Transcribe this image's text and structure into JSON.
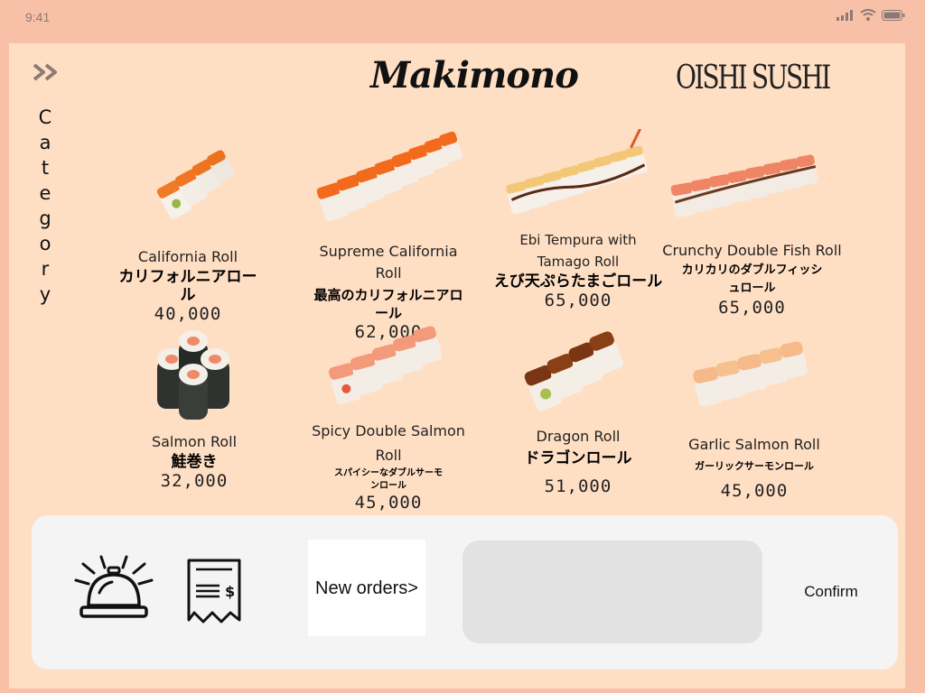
{
  "status_bar": {
    "time": "9:41"
  },
  "header": {
    "title": "Makimono",
    "brand": "OISHI SUSHI",
    "category_label": [
      "C",
      "a",
      "t",
      "e",
      "g",
      "o",
      "r",
      "y"
    ]
  },
  "menu": {
    "items": [
      {
        "name": "California Roll",
        "name_jp": "カリフォルニアロール",
        "price": "40,000"
      },
      {
        "name": "Supreme California Roll",
        "name_jp": "最高のカリフォルニアロール",
        "price": "62,000"
      },
      {
        "name": "Ebi Tempura with Tamago Roll",
        "name_jp": "えび天ぷらたまごロール",
        "price": "65,000"
      },
      {
        "name": "Crunchy Double Fish Roll",
        "name_jp": "カリカリのダブルフィッシュロール",
        "price": "65,000"
      },
      {
        "name": "Salmon Roll",
        "name_jp": "鮭巻き",
        "price": "32,000"
      },
      {
        "name": "Spicy Double Salmon Roll",
        "name_jp": "スパイシーなダブルサーモンロール",
        "price": "45,000"
      },
      {
        "name": "Dragon Roll",
        "name_jp": "ドラゴンロール",
        "price": "51,000"
      },
      {
        "name": "Garlic Salmon Roll",
        "name_jp": "ガーリックサーモンロール",
        "price": "45,000"
      }
    ]
  },
  "bottom_bar": {
    "bell_icon": "service-bell-icon",
    "receipt_icon": "receipt-icon",
    "new_orders_label": "New orders>",
    "confirm_label": "Confirm"
  },
  "colors": {
    "background": "#f9c0a8",
    "panel": "#ffdfc4",
    "bottom_bar": "#f4f4f4",
    "order_box": "#e2e2e2"
  }
}
